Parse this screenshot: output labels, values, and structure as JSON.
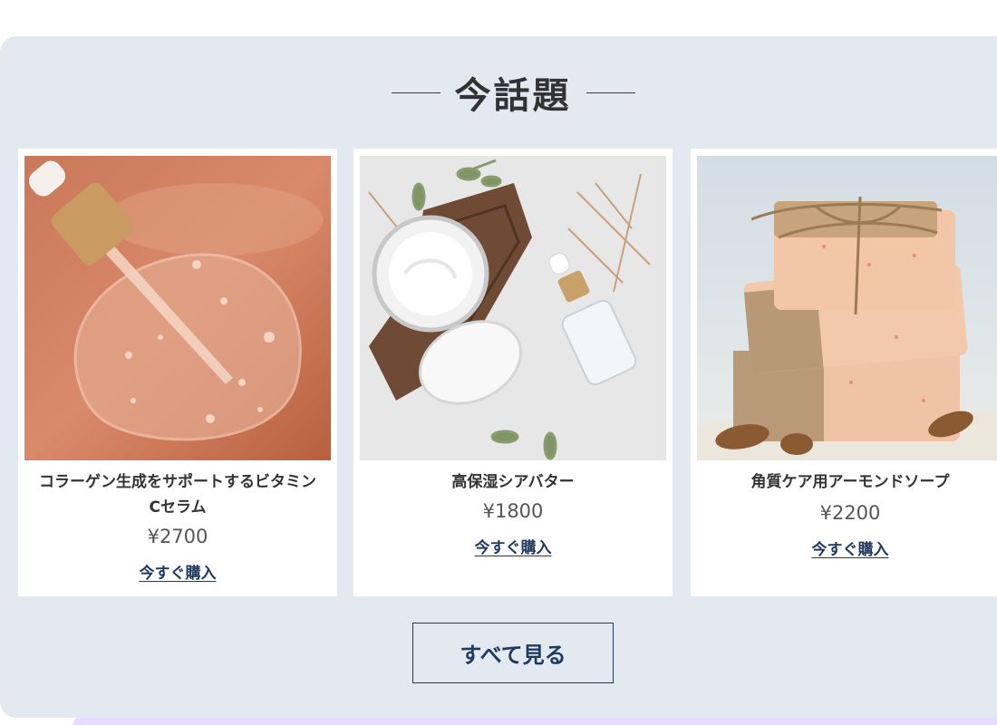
{
  "section": {
    "title": "今話題",
    "view_all_label": "すべて見る"
  },
  "products": [
    {
      "name": "コラーゲン生成をサポートするビタミンCセラム",
      "price": "¥2700",
      "buy_label": "今すぐ購入",
      "image": "vitamin-c-serum-dropper"
    },
    {
      "name": "高保湿シアバター",
      "price": "¥1800",
      "buy_label": "今すぐ購入",
      "image": "shea-butter-jar"
    },
    {
      "name": "角質ケア用アーモンドソープ",
      "price": "¥2200",
      "buy_label": "今すぐ購入",
      "image": "almond-soap-bars"
    }
  ],
  "colors": {
    "section_bg": "#e3e9f1",
    "accent": "#1e3a5f",
    "text": "#333333"
  }
}
